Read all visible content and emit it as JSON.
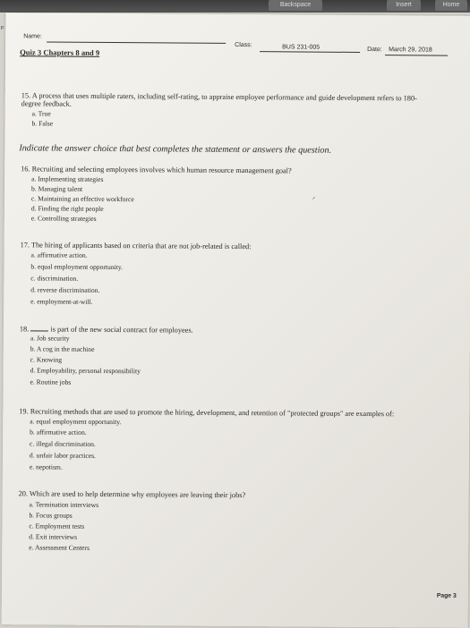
{
  "keyboard": {
    "keys": [
      "Backspace",
      "Insert",
      "Home"
    ]
  },
  "header": {
    "name_label": "Name:",
    "class_label": "Class:",
    "class_value": "BUS 231-005",
    "date_label": "Date:",
    "date_value": "March 29, 2018",
    "quiz_title": "Quiz 3 Chapters 8 and 9"
  },
  "questions": [
    {
      "number": "15.",
      "text_lines": [
        "A process that uses multiple raters, including self-rating, to appraise employee performance and guide development refers to 180-",
        "degree feedback."
      ],
      "options": [
        "a. True",
        "b. False"
      ]
    },
    {
      "number": "16.",
      "text_lines": [
        "Recruiting and selecting employees involves which human resource management goal?"
      ],
      "options": [
        "a. Implementing strategies",
        "b. Managing talent",
        "c. Maintaining an effective workforce",
        "d. Finding the right people",
        "e. Controlling strategies"
      ]
    },
    {
      "number": "17.",
      "text_lines": [
        "The hiring of applicants based on criteria that are not job-related is called:"
      ],
      "options": [
        "a. affirmative action.",
        "b. equal employment opportunity.",
        "c. discrimination.",
        "d. reverse discrimination.",
        "e. employment-at-will."
      ]
    },
    {
      "number": "18.",
      "text_lines": [
        "is part of the new social contract for employees."
      ],
      "options": [
        "a. Job security",
        "b. A cog in the machine",
        "c. Knowing",
        "d. Employability, personal responsibility",
        "e. Routine jobs"
      ]
    },
    {
      "number": "19.",
      "text_lines": [
        "Recruiting methods that are used to promote the hiring, development, and retention of \"protected groups\" are examples of:"
      ],
      "options": [
        "a. equal employment opportunity.",
        "b. affirmative action.",
        "c. illegal discrimination.",
        "d. unfair labor practices.",
        "e. nepotism."
      ]
    },
    {
      "number": "20.",
      "text_lines": [
        "Which are used to help determine why employees are leaving their jobs?"
      ],
      "options": [
        "a. Termination interviews",
        "b. Focus groups",
        "c. Employment tests",
        "d. Exit interviews",
        "e. Assessment Centers"
      ]
    }
  ],
  "instruction": "Indicate the answer choice that best completes the statement or answers the question.",
  "footer": {
    "page_label": "Page 3"
  }
}
